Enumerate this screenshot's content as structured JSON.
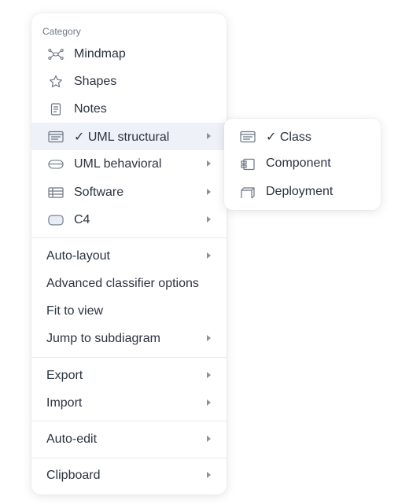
{
  "menu": {
    "category_header": "Category",
    "categories": [
      {
        "label": "Mindmap",
        "icon": "mindmap-icon",
        "submenu": false
      },
      {
        "label": "Shapes",
        "icon": "star-icon",
        "submenu": false
      },
      {
        "label": "Notes",
        "icon": "note-icon",
        "submenu": false
      },
      {
        "label": "✓ UML structural",
        "icon": "uml-class-icon",
        "submenu": true,
        "active": true
      },
      {
        "label": "UML behavioral",
        "icon": "pill-icon",
        "submenu": true
      },
      {
        "label": "Software",
        "icon": "table-icon",
        "submenu": true
      },
      {
        "label": "C4",
        "icon": "rounded-rect-icon",
        "submenu": true
      }
    ],
    "actions_group1": [
      {
        "label": "Auto-layout",
        "submenu": true
      },
      {
        "label": "Advanced classifier options",
        "submenu": false
      },
      {
        "label": "Fit to view",
        "submenu": false
      },
      {
        "label": "Jump to subdiagram",
        "submenu": true
      }
    ],
    "actions_group2": [
      {
        "label": "Export",
        "submenu": true
      },
      {
        "label": "Import",
        "submenu": true
      }
    ],
    "actions_group3": [
      {
        "label": "Auto-edit",
        "submenu": true
      }
    ],
    "actions_group4": [
      {
        "label": "Clipboard",
        "submenu": true
      }
    ]
  },
  "submenu": {
    "items": [
      {
        "label": "✓ Class",
        "icon": "uml-class-icon"
      },
      {
        "label": "Component",
        "icon": "component-icon"
      },
      {
        "label": "Deployment",
        "icon": "deployment-node-icon"
      }
    ]
  },
  "colors": {
    "text": "#2b3440",
    "muted": "#707986",
    "icon": "#6b7684",
    "active_bg": "#eef1f7",
    "divider": "#e6e9ee"
  }
}
